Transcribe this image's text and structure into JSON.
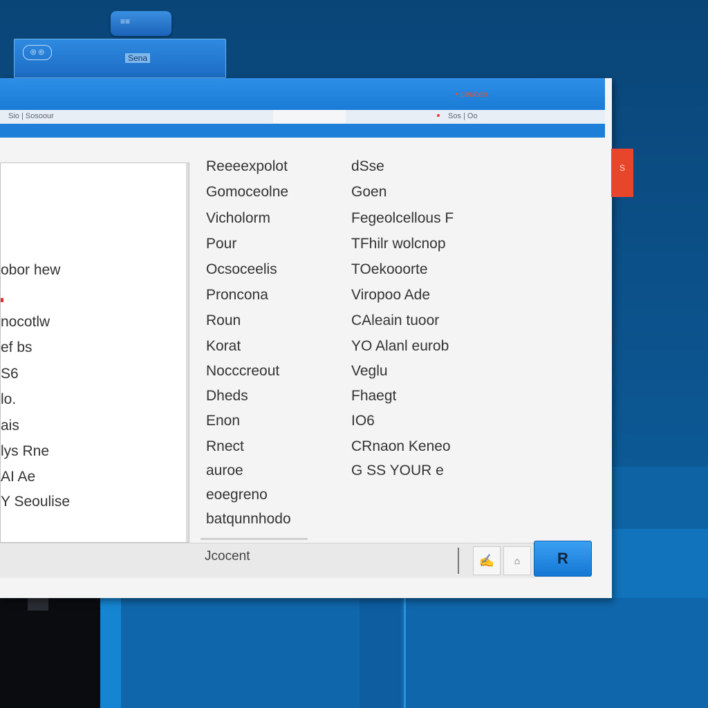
{
  "tray": {
    "label": "≡≡"
  },
  "back_window": {
    "icon_text": "◎ ◎",
    "label": "Sena"
  },
  "dialog": {
    "title_right": "• ceuceo",
    "menu_left": "Sio | Sosoour",
    "menu_right": "Sos  | Oo"
  },
  "left_list": [
    "obor hew",
    "nocotlw",
    "ef bs",
    "S6",
    "lo.",
    "ais",
    "lys Rne",
    "AI Ae",
    "Y Seoulise"
  ],
  "col1": [
    "Reeeexpolot",
    "Gomoceolne",
    "Vicholorm",
    "Pour",
    "Ocsoceelis",
    "Proncona",
    "Roun",
    "Korat",
    "Nocccreout",
    "Dheds",
    "Enon",
    "Rnect",
    "auroe",
    "eoegreno",
    "batqunnhodo"
  ],
  "col2": [
    "dSse",
    "Goen",
    "Fegeolcellous  F",
    "TFhilr wolcnop",
    "TOekooorte",
    "Viropoo Ade",
    "CAleain tuoor",
    "YO Alanl eurob",
    "Veglu",
    "Fhaegt",
    "IO6",
    "CRnaon Keneo",
    "G SS YOUR e"
  ],
  "footer": {
    "label": "Jcocent",
    "ok_label": "R",
    "tool1": "✍",
    "tool2": "⌂"
  },
  "badge": {
    "label": "S"
  },
  "colors": {
    "accent": "#1e7fd8",
    "desktop": "#0b4f86",
    "badge": "#e8462a"
  }
}
